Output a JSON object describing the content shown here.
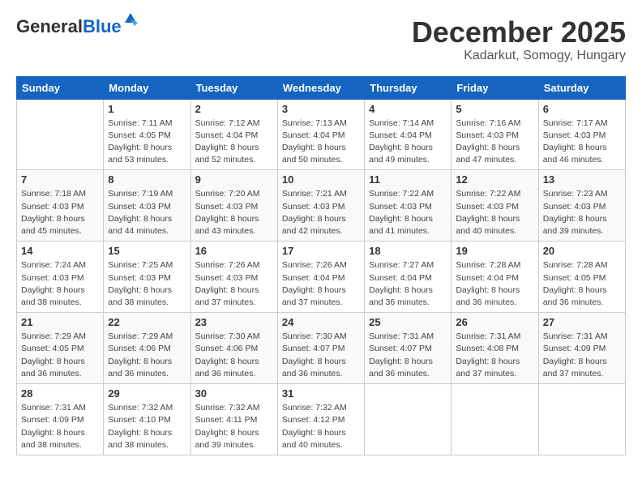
{
  "logo": {
    "general": "General",
    "blue": "Blue"
  },
  "title": "December 2025",
  "subtitle": "Kadarkut, Somogy, Hungary",
  "days_of_week": [
    "Sunday",
    "Monday",
    "Tuesday",
    "Wednesday",
    "Thursday",
    "Friday",
    "Saturday"
  ],
  "weeks": [
    [
      {
        "day": "",
        "sunrise": "",
        "sunset": "",
        "daylight": ""
      },
      {
        "day": "1",
        "sunrise": "Sunrise: 7:11 AM",
        "sunset": "Sunset: 4:05 PM",
        "daylight": "Daylight: 8 hours and 53 minutes."
      },
      {
        "day": "2",
        "sunrise": "Sunrise: 7:12 AM",
        "sunset": "Sunset: 4:04 PM",
        "daylight": "Daylight: 8 hours and 52 minutes."
      },
      {
        "day": "3",
        "sunrise": "Sunrise: 7:13 AM",
        "sunset": "Sunset: 4:04 PM",
        "daylight": "Daylight: 8 hours and 50 minutes."
      },
      {
        "day": "4",
        "sunrise": "Sunrise: 7:14 AM",
        "sunset": "Sunset: 4:04 PM",
        "daylight": "Daylight: 8 hours and 49 minutes."
      },
      {
        "day": "5",
        "sunrise": "Sunrise: 7:16 AM",
        "sunset": "Sunset: 4:03 PM",
        "daylight": "Daylight: 8 hours and 47 minutes."
      },
      {
        "day": "6",
        "sunrise": "Sunrise: 7:17 AM",
        "sunset": "Sunset: 4:03 PM",
        "daylight": "Daylight: 8 hours and 46 minutes."
      }
    ],
    [
      {
        "day": "7",
        "sunrise": "Sunrise: 7:18 AM",
        "sunset": "Sunset: 4:03 PM",
        "daylight": "Daylight: 8 hours and 45 minutes."
      },
      {
        "day": "8",
        "sunrise": "Sunrise: 7:19 AM",
        "sunset": "Sunset: 4:03 PM",
        "daylight": "Daylight: 8 hours and 44 minutes."
      },
      {
        "day": "9",
        "sunrise": "Sunrise: 7:20 AM",
        "sunset": "Sunset: 4:03 PM",
        "daylight": "Daylight: 8 hours and 43 minutes."
      },
      {
        "day": "10",
        "sunrise": "Sunrise: 7:21 AM",
        "sunset": "Sunset: 4:03 PM",
        "daylight": "Daylight: 8 hours and 42 minutes."
      },
      {
        "day": "11",
        "sunrise": "Sunrise: 7:22 AM",
        "sunset": "Sunset: 4:03 PM",
        "daylight": "Daylight: 8 hours and 41 minutes."
      },
      {
        "day": "12",
        "sunrise": "Sunrise: 7:22 AM",
        "sunset": "Sunset: 4:03 PM",
        "daylight": "Daylight: 8 hours and 40 minutes."
      },
      {
        "day": "13",
        "sunrise": "Sunrise: 7:23 AM",
        "sunset": "Sunset: 4:03 PM",
        "daylight": "Daylight: 8 hours and 39 minutes."
      }
    ],
    [
      {
        "day": "14",
        "sunrise": "Sunrise: 7:24 AM",
        "sunset": "Sunset: 4:03 PM",
        "daylight": "Daylight: 8 hours and 38 minutes."
      },
      {
        "day": "15",
        "sunrise": "Sunrise: 7:25 AM",
        "sunset": "Sunset: 4:03 PM",
        "daylight": "Daylight: 8 hours and 38 minutes."
      },
      {
        "day": "16",
        "sunrise": "Sunrise: 7:26 AM",
        "sunset": "Sunset: 4:03 PM",
        "daylight": "Daylight: 8 hours and 37 minutes."
      },
      {
        "day": "17",
        "sunrise": "Sunrise: 7:26 AM",
        "sunset": "Sunset: 4:04 PM",
        "daylight": "Daylight: 8 hours and 37 minutes."
      },
      {
        "day": "18",
        "sunrise": "Sunrise: 7:27 AM",
        "sunset": "Sunset: 4:04 PM",
        "daylight": "Daylight: 8 hours and 36 minutes."
      },
      {
        "day": "19",
        "sunrise": "Sunrise: 7:28 AM",
        "sunset": "Sunset: 4:04 PM",
        "daylight": "Daylight: 8 hours and 36 minutes."
      },
      {
        "day": "20",
        "sunrise": "Sunrise: 7:28 AM",
        "sunset": "Sunset: 4:05 PM",
        "daylight": "Daylight: 8 hours and 36 minutes."
      }
    ],
    [
      {
        "day": "21",
        "sunrise": "Sunrise: 7:29 AM",
        "sunset": "Sunset: 4:05 PM",
        "daylight": "Daylight: 8 hours and 36 minutes."
      },
      {
        "day": "22",
        "sunrise": "Sunrise: 7:29 AM",
        "sunset": "Sunset: 4:06 PM",
        "daylight": "Daylight: 8 hours and 36 minutes."
      },
      {
        "day": "23",
        "sunrise": "Sunrise: 7:30 AM",
        "sunset": "Sunset: 4:06 PM",
        "daylight": "Daylight: 8 hours and 36 minutes."
      },
      {
        "day": "24",
        "sunrise": "Sunrise: 7:30 AM",
        "sunset": "Sunset: 4:07 PM",
        "daylight": "Daylight: 8 hours and 36 minutes."
      },
      {
        "day": "25",
        "sunrise": "Sunrise: 7:31 AM",
        "sunset": "Sunset: 4:07 PM",
        "daylight": "Daylight: 8 hours and 36 minutes."
      },
      {
        "day": "26",
        "sunrise": "Sunrise: 7:31 AM",
        "sunset": "Sunset: 4:08 PM",
        "daylight": "Daylight: 8 hours and 37 minutes."
      },
      {
        "day": "27",
        "sunrise": "Sunrise: 7:31 AM",
        "sunset": "Sunset: 4:09 PM",
        "daylight": "Daylight: 8 hours and 37 minutes."
      }
    ],
    [
      {
        "day": "28",
        "sunrise": "Sunrise: 7:31 AM",
        "sunset": "Sunset: 4:09 PM",
        "daylight": "Daylight: 8 hours and 38 minutes."
      },
      {
        "day": "29",
        "sunrise": "Sunrise: 7:32 AM",
        "sunset": "Sunset: 4:10 PM",
        "daylight": "Daylight: 8 hours and 38 minutes."
      },
      {
        "day": "30",
        "sunrise": "Sunrise: 7:32 AM",
        "sunset": "Sunset: 4:11 PM",
        "daylight": "Daylight: 8 hours and 39 minutes."
      },
      {
        "day": "31",
        "sunrise": "Sunrise: 7:32 AM",
        "sunset": "Sunset: 4:12 PM",
        "daylight": "Daylight: 8 hours and 40 minutes."
      },
      {
        "day": "",
        "sunrise": "",
        "sunset": "",
        "daylight": ""
      },
      {
        "day": "",
        "sunrise": "",
        "sunset": "",
        "daylight": ""
      },
      {
        "day": "",
        "sunrise": "",
        "sunset": "",
        "daylight": ""
      }
    ]
  ]
}
